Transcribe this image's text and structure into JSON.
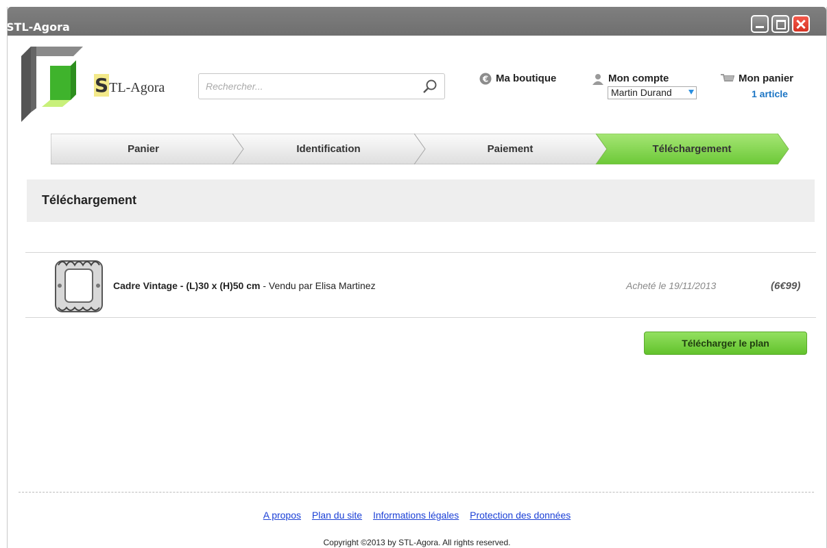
{
  "window": {
    "title": "STL-Agora"
  },
  "logo": {
    "initial": "S",
    "rest": "TL-Agora"
  },
  "search": {
    "placeholder": "Rechercher..."
  },
  "header": {
    "boutique_label": "Ma boutique",
    "account_label": "Mon compte",
    "account_user": "Martin Durand",
    "cart_label": "Mon panier",
    "cart_count": "1 article"
  },
  "steps": [
    "Panier",
    "Identification",
    "Paiement",
    "Téléchargement"
  ],
  "active_step": "Téléchargement",
  "section": {
    "title": "Téléchargement"
  },
  "item": {
    "name": "Cadre Vintage - (L)30 x (H)50 cm",
    "seller": " - Vendu par Elisa Martinez",
    "date": "Acheté le 19/11/2013",
    "price": "(6€99)"
  },
  "download_button": "Télécharger le plan",
  "footer": {
    "links": [
      "A propos",
      "Plan du site",
      "Informations légales",
      "Protection des données"
    ],
    "copyright": "Copyright ©2013 by STL-Agora. All rights reserved."
  },
  "colors": {
    "accent_green": "#7ed348",
    "link_blue": "#1a74c4",
    "titlebar": "#777777"
  }
}
